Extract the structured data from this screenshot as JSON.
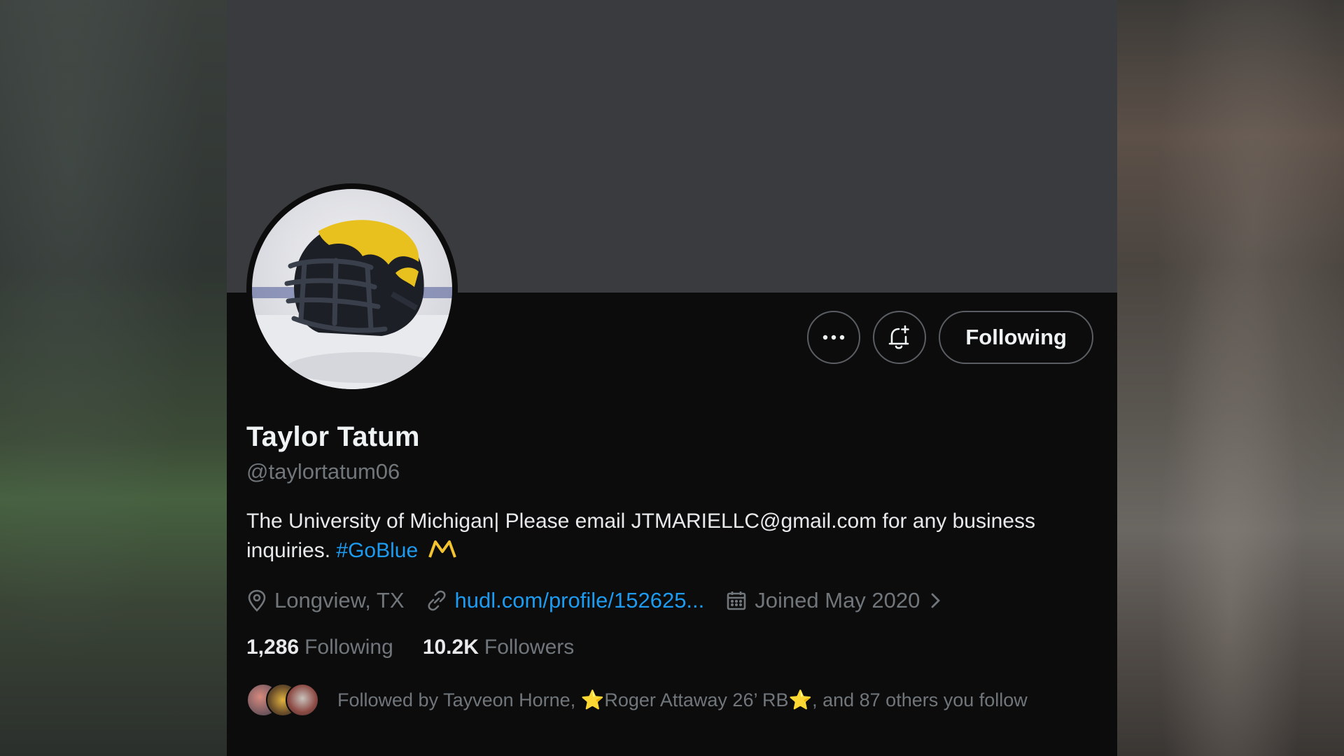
{
  "profile": {
    "display_name": "Taylor Tatum",
    "handle": "@taylortatum06",
    "bio_text": "The University of Michigan| Please email JTMARIELLC@gmail.com for any business inquiries.",
    "bio_hashtag": "#GoBlue",
    "location": "Longview, TX",
    "website": "hudl.com/profile/152625...",
    "joined": "Joined May 2020",
    "following_count": "1,286",
    "following_label": "Following",
    "followers_count": "10.2K",
    "followers_label": "Followers"
  },
  "actions": {
    "more_icon": "more-horizontal-icon",
    "notify_icon": "bell-plus-icon",
    "follow_label": "Following"
  },
  "followed_by": {
    "prefix": "Followed by Tayveon Horne, ",
    "star": "⭐",
    "name2": "Roger Attaway 26’ RB",
    "suffix": ", and 87 others you follow"
  },
  "colors": {
    "background": "#0c0c0c",
    "banner": "#3a3b3e",
    "text_primary": "#e7e9ea",
    "text_secondary": "#71767b",
    "link": "#1d9bf0",
    "maize": "#f4c430"
  }
}
